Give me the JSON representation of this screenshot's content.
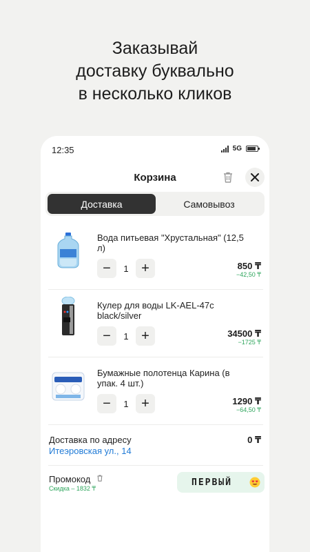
{
  "headline": {
    "line1": "Заказывай",
    "line2": "доставку буквально",
    "line3": "в несколько кликов"
  },
  "status_bar": {
    "time": "12:35",
    "network": "5G"
  },
  "header": {
    "title": "Корзина",
    "trash_icon": "trash-icon",
    "close_icon": "close-icon"
  },
  "tabs": {
    "delivery": "Доставка",
    "pickup": "Самовывоз",
    "active": "delivery"
  },
  "items": [
    {
      "name": "Вода питьевая \"Хрустальная\" (12,5 л)",
      "qty": "1",
      "price": "850 ₸",
      "discount": "−42,50 ₸",
      "image": "water-bottle"
    },
    {
      "name": "Кулер для воды LK-AEL-47c black/silver",
      "qty": "1",
      "price": "34500 ₸",
      "discount": "−1725 ₸",
      "image": "water-cooler"
    },
    {
      "name": "Бумажные полотенца Карина (в упак. 4 шт.)",
      "qty": "1",
      "price": "1290 ₸",
      "discount": "−64,50 ₸",
      "image": "paper-towels"
    }
  ],
  "qty_buttons": {
    "minus": "−",
    "plus": "+"
  },
  "delivery": {
    "label": "Доставка по адресу",
    "price": "0 ₸",
    "address": "Итеэровская ул., 14"
  },
  "promo": {
    "label": "Промокод",
    "discount": "Скидка – 1832 ₸",
    "code": "ПЕРВЫЙ",
    "emoji": "heart-eyes-emoji"
  },
  "colors": {
    "accent_green": "#2ea55c",
    "link_blue": "#1f7ad6",
    "active_tab": "#323232",
    "promo_bg": "#e6f5ec"
  }
}
